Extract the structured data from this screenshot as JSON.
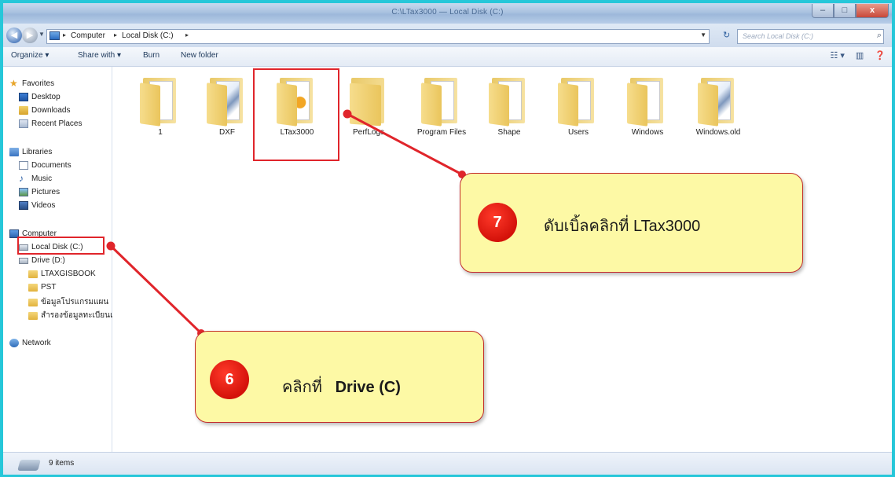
{
  "window": {
    "title": "C:\\LTax3000 — Local Disk (C:)",
    "controls": [
      "–",
      "□",
      "x"
    ]
  },
  "address": {
    "crumbs": [
      "Computer",
      "Local Disk (C:)"
    ],
    "search_placeholder": "Search Local Disk (C:)"
  },
  "toolbar": {
    "organize": "Organize ▾",
    "share_with": "Share with ▾",
    "burn": "Burn",
    "new_folder": "New folder"
  },
  "nav": {
    "favorites": "Favorites",
    "desktop": "Desktop",
    "downloads": "Downloads",
    "recent_places": "Recent Places",
    "libraries": "Libraries",
    "documents": "Documents",
    "music": "Music",
    "pictures": "Pictures",
    "videos": "Videos",
    "computer": "Computer",
    "local_disk": "Local Disk (C:)",
    "drive_d": "Drive (D:)",
    "ltaxgisbook": "LTAXGISBOOK",
    "pst": "PST",
    "thai_folder_1": "ข้อมูลโปรแกรมแผน",
    "thai_folder_2": "สำรองข้อมูลทะเบียนแ",
    "network": "Network"
  },
  "folders": [
    {
      "label": "1",
      "style": "paper"
    },
    {
      "label": "DXF",
      "style": "pic"
    },
    {
      "label": "LTax3000",
      "style": "orb"
    },
    {
      "label": "PerfLogs",
      "style": "plain"
    },
    {
      "label": "Program Files",
      "style": "paper"
    },
    {
      "label": "Shape",
      "style": "paper"
    },
    {
      "label": "Users",
      "style": "paper"
    },
    {
      "label": "Windows",
      "style": "paper"
    },
    {
      "label": "Windows.old",
      "style": "pic"
    }
  ],
  "status": {
    "items": "9 items"
  },
  "callouts": {
    "step7": {
      "number": "7",
      "text": "ดับเบิ้ลคลิกที่ LTax3000"
    },
    "step6": {
      "number": "6",
      "text_prefix": "คลิกที่",
      "text_bold": "Drive (C)"
    }
  },
  "colors": {
    "annotation_red": "#e0252b",
    "callout_fill": "#fdf9a5",
    "frame": "#26c7d9"
  }
}
